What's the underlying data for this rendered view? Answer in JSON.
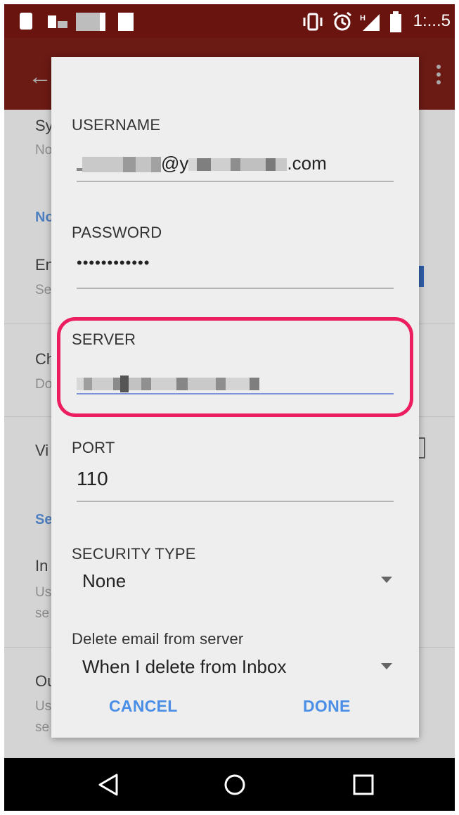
{
  "status_bar": {
    "time": "1:...5",
    "icons": [
      "vibrate-icon",
      "alarm-icon",
      "signal-icon",
      "battery-icon"
    ]
  },
  "dialog": {
    "username": {
      "label": "USERNAME",
      "value_visible_suffix": ".com",
      "value_at": "@y"
    },
    "password": {
      "label": "PASSWORD",
      "value": "••••••••••••"
    },
    "server": {
      "label": "SERVER"
    },
    "port": {
      "label": "PORT",
      "value": "110"
    },
    "security_type": {
      "label": "SECURITY TYPE",
      "selected": "None"
    },
    "delete_email": {
      "label": "Delete email from server",
      "selected": "When I delete from Inbox"
    },
    "buttons": {
      "cancel": "CANCEL",
      "done": "DONE"
    }
  },
  "background": {
    "fragments": [
      {
        "text": "Sy",
        "style": "title"
      },
      {
        "text": "No",
        "style": "sub"
      },
      {
        "text": "No",
        "style": "head"
      },
      {
        "text": "En",
        "style": "title"
      },
      {
        "text": "Se",
        "style": "sub"
      },
      {
        "text": "Ch",
        "style": "title"
      },
      {
        "text": "Do",
        "style": "sub"
      },
      {
        "text": "Vi",
        "style": "title"
      },
      {
        "text": "Se",
        "style": "head"
      },
      {
        "text": "In",
        "style": "title"
      },
      {
        "text": "Us",
        "style": "sub"
      },
      {
        "text": "se",
        "style": "sub"
      },
      {
        "text": "Ou",
        "style": "title"
      },
      {
        "text": "Us",
        "style": "sub"
      },
      {
        "text": "se",
        "style": "sub"
      }
    ]
  },
  "colors": {
    "app_bar": "#6c1a14",
    "highlight": "#ec1e5f",
    "button_text": "#4a8ee6",
    "active_underline": "#7b93d6"
  }
}
